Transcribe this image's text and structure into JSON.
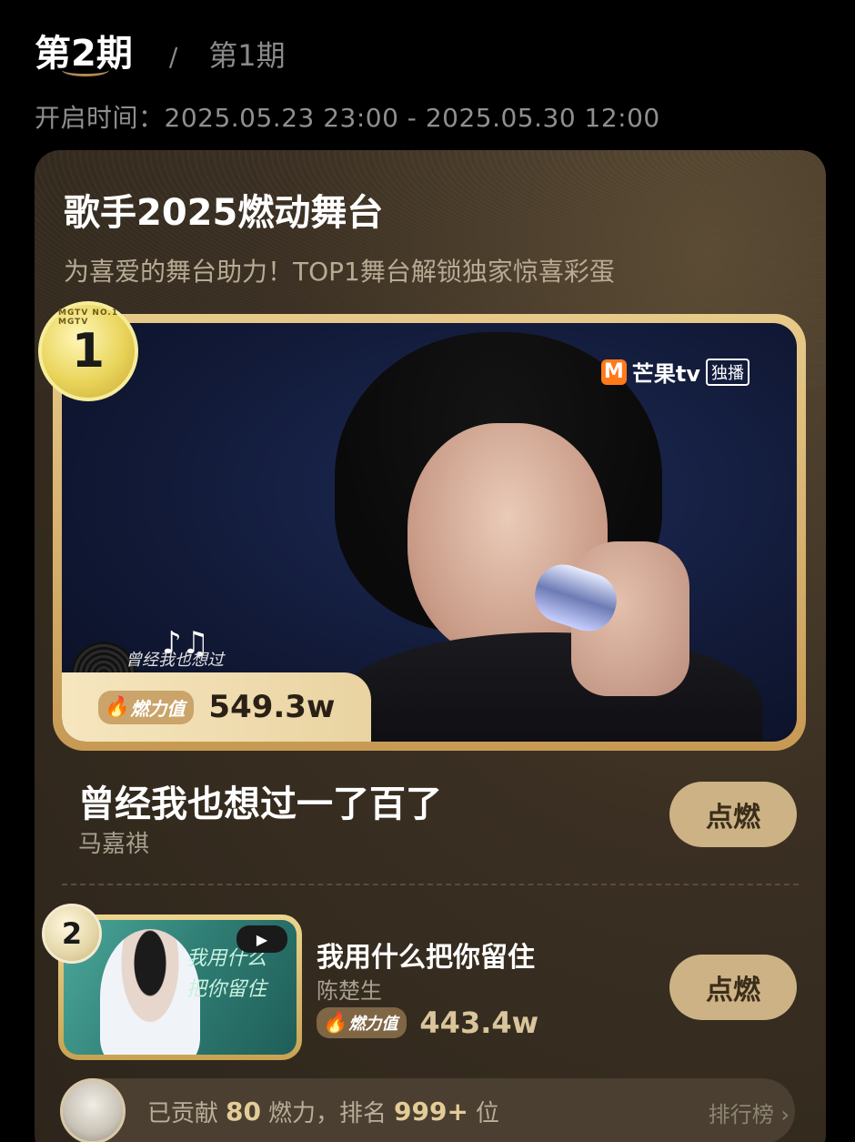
{
  "tabs": {
    "active": "第2期",
    "separator": "/",
    "inactive": "第1期"
  },
  "open_time": "开启时间：2025.05.23 23:00 - 2025.05.30 12:00",
  "card": {
    "title": "歌手2025燃动舞台",
    "subtitle": "为喜爱的舞台助力！TOP1舞台解锁独家惊喜彩蛋"
  },
  "top1": {
    "rank": "1",
    "badge_ribbon": "MGTV NO.1 MGTV",
    "logo_m": "M",
    "logo_text": "芒果tv",
    "logo_tag": "独播",
    "lyric": "曾经我也想过",
    "power_label": "燃力值",
    "power_value": "549.3w",
    "song_title": "曾经我也想过一了百了",
    "artist": "马嘉祺",
    "button": "点燃"
  },
  "top2": {
    "rank": "2",
    "calligraphy_line1": "我用什么",
    "calligraphy_line2": "把你留住",
    "song_title": "我用什么把你留住",
    "artist": "陈楚生",
    "power_label": "燃力值",
    "power_value": "443.4w",
    "button": "点燃"
  },
  "contribution": {
    "prefix": "已贡献",
    "amount": "80",
    "mid": "燃力，排名",
    "rank": "999+",
    "suffix": "位",
    "leaderboard": "排行榜 ›"
  },
  "colors": {
    "accent_gold": "#cdb285",
    "fire": "#e34a1f",
    "card_bg": "#3a2f22"
  }
}
